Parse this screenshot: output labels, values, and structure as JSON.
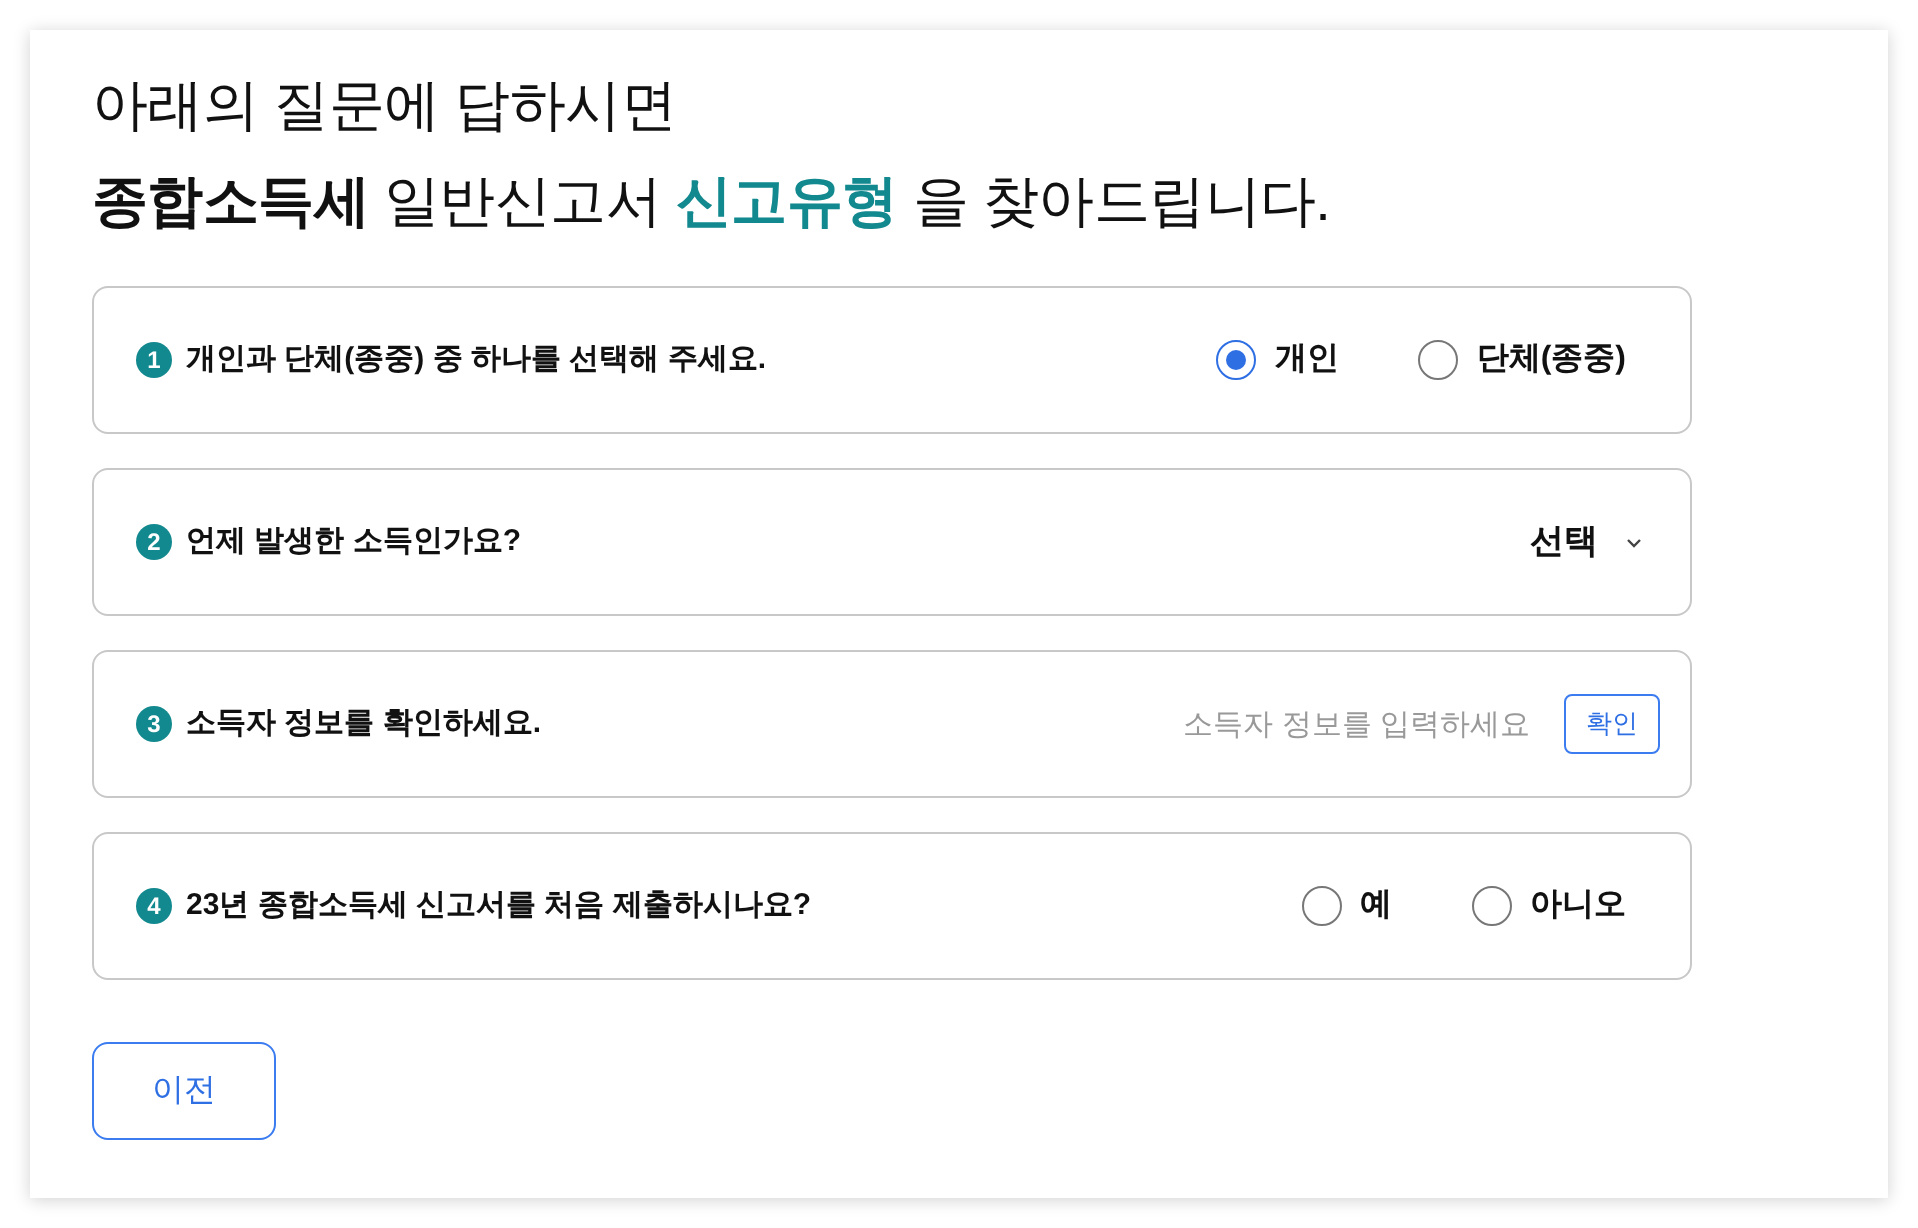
{
  "heading": {
    "line_1": "아래의 질문에 답하시면",
    "line_2": [
      {
        "text": "종합소득세",
        "kind": "bold"
      },
      {
        "text": " 일반신고서 ",
        "kind": "plain"
      },
      {
        "text": "신고유형",
        "kind": "highlight"
      },
      {
        "text": " 을 찾아드립니다.",
        "kind": "plain"
      }
    ]
  },
  "questions": [
    {
      "number": "1",
      "text": "개인과 단체(종중) 중 하나를 선택해 주세요.",
      "kind": "radio",
      "options": [
        {
          "label": "개인",
          "selected": true
        },
        {
          "label": "단체(종중)",
          "selected": false
        }
      ]
    },
    {
      "number": "2",
      "text": "언제 발생한 소득인가요?",
      "kind": "select",
      "value": "선택"
    },
    {
      "number": "3",
      "text": "소득자 정보를 확인하세요.",
      "kind": "input",
      "placeholder": "소득자 정보를 입력하세요",
      "button": "확인"
    },
    {
      "number": "4",
      "text": "23년 종합소득세 신고서를 처음 제출하시나요?",
      "kind": "radio",
      "options": [
        {
          "label": "예",
          "selected": false
        },
        {
          "label": "아니오",
          "selected": false
        }
      ]
    }
  ],
  "back_button": "이전"
}
